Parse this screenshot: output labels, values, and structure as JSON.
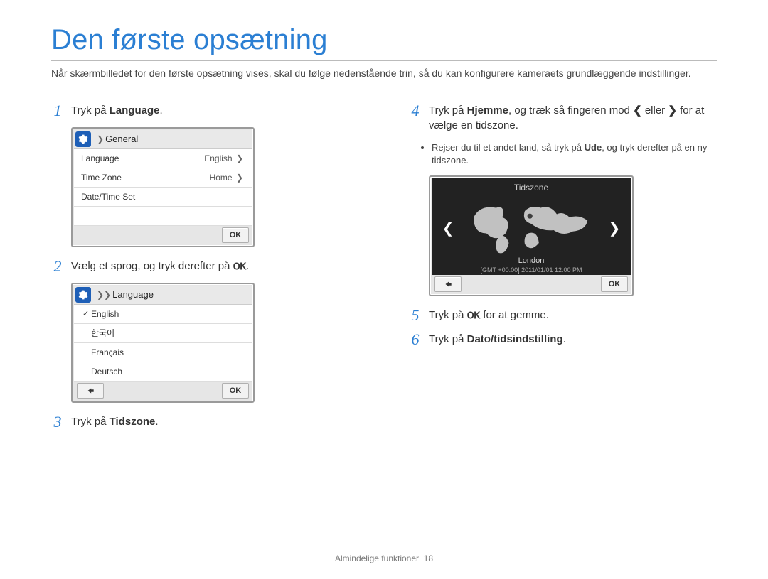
{
  "title": "Den første opsætning",
  "intro": "Når skærmbilledet for den første opsætning vises, skal du følge nedenstående trin, så du kan konfigurere kameraets grundlæggende indstillinger.",
  "steps": {
    "s1_pre": "Tryk på ",
    "s1_bold": "Language",
    "s1_post": ".",
    "s2_pre": "Vælg et sprog, og tryk derefter på ",
    "s2_post": ".",
    "s3_pre": "Tryk på ",
    "s3_bold": "Tidszone",
    "s3_post": ".",
    "s4_pre": "Tryk på ",
    "s4_bold": "Hjemme",
    "s4_mid": ", og træk så fingeren mod ",
    "s4_or": " eller ",
    "s4_end": " for at vælge en tidszone.",
    "s4_bullet_pre": "Rejser du til et andet land, så tryk på ",
    "s4_bullet_bold": "Ude",
    "s4_bullet_post": ", og tryk derefter på en ny tidszone.",
    "s5_pre": "Tryk på ",
    "s5_post": " for at gemme.",
    "s6_pre": "Tryk på ",
    "s6_bold": "Dato/tidsindstilling",
    "s6_post": "."
  },
  "ok_label": "OK",
  "device1": {
    "crumb_prefix": "❯",
    "crumb": "General",
    "items": [
      {
        "label": "Language",
        "value": "English"
      },
      {
        "label": "Time Zone",
        "value": "Home"
      },
      {
        "label": "Date/Time Set",
        "value": ""
      }
    ],
    "ok": "OK"
  },
  "device2": {
    "crumb_prefix": "❯❯",
    "crumb": "Language",
    "options": [
      {
        "label": "English",
        "checked": true
      },
      {
        "label": "한국어",
        "checked": false
      },
      {
        "label": "Français",
        "checked": false
      },
      {
        "label": "Deutsch",
        "checked": false
      }
    ],
    "ok": "OK"
  },
  "device3": {
    "title": "Tidszone",
    "city": "London",
    "meta": "[GMT +00:00]  2011/01/01  12:00 PM",
    "ok": "OK"
  },
  "footer": {
    "chapter": "Almindelige funktioner",
    "page": "18"
  }
}
